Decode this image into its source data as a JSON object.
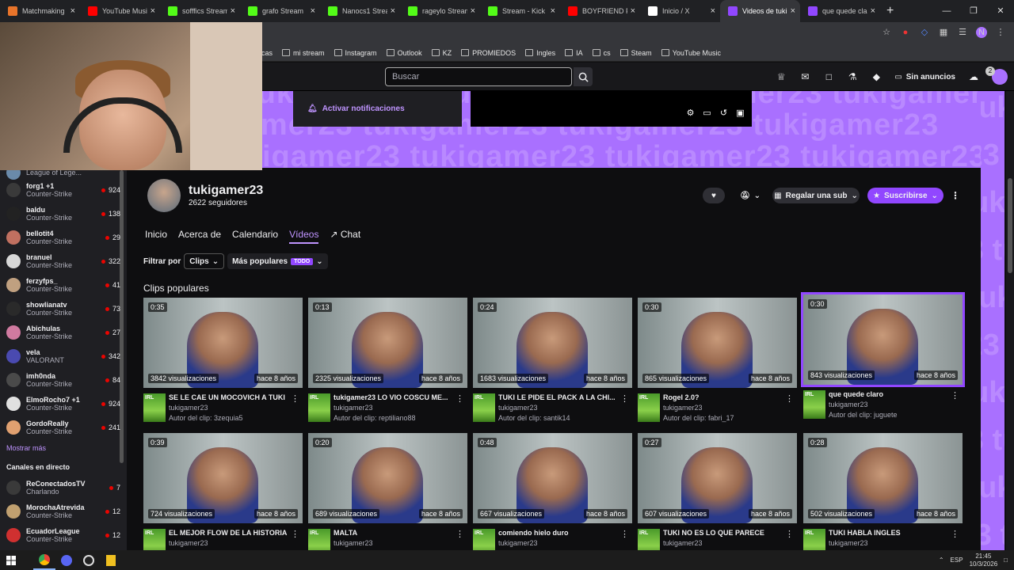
{
  "browser": {
    "tabs": [
      {
        "title": "Matchmaking",
        "fav": "#e8742a"
      },
      {
        "title": "YouTube Music",
        "fav": "#ff0000"
      },
      {
        "title": "sofffics Stream",
        "fav": "#53fc18"
      },
      {
        "title": "grafo Stream",
        "fav": "#53fc18"
      },
      {
        "title": "Nanocs1 Stream",
        "fav": "#53fc18"
      },
      {
        "title": "rageylo Stream",
        "fav": "#53fc18"
      },
      {
        "title": "Stream - Kick",
        "fav": "#53fc18"
      },
      {
        "title": "BOYFRIEND FT",
        "fav": "#ff0000"
      },
      {
        "title": "Inicio / X",
        "fav": "#ffffff"
      },
      {
        "title": "Videos de tuki",
        "fav": "#9147ff"
      },
      {
        "title": "que quede cla",
        "fav": "#9147ff"
      }
    ],
    "bookmarks": [
      "cas",
      "mi stream",
      "Instagram",
      "Outlook",
      "KZ",
      "PROMIEDOS",
      "Ingles",
      "IA",
      "cs",
      "Steam",
      "YouTube Music"
    ]
  },
  "twitch": {
    "search_placeholder": "Buscar",
    "noads_label": "Sin anuncios",
    "notif_count": "2",
    "activate_notifications": "Activar notificaciones"
  },
  "sidebar": {
    "channels": [
      {
        "name": "",
        "game": "League of Lege...",
        "viewers": "",
        "color": "#6a8aaa"
      },
      {
        "name": "forg1 +1",
        "game": "Counter-Strike",
        "viewers": "924",
        "color": "#3a3a3a"
      },
      {
        "name": "baldu",
        "game": "Counter-Strike",
        "viewers": "138",
        "color": "#222222"
      },
      {
        "name": "bellotit4",
        "game": "Counter-Strike",
        "viewers": "29",
        "color": "#c07060"
      },
      {
        "name": "branuel",
        "game": "Counter-Strike",
        "viewers": "322",
        "color": "#d8d8d8"
      },
      {
        "name": "ferzyfps_",
        "game": "Counter-Strike",
        "viewers": "41",
        "color": "#c0a080"
      },
      {
        "name": "showlianatv",
        "game": "Counter-Strike",
        "viewers": "73",
        "color": "#2a2a2a"
      },
      {
        "name": "Abichulas",
        "game": "Counter-Strike",
        "viewers": "27",
        "color": "#d07aa0"
      },
      {
        "name": "vela",
        "game": "VALORANT",
        "viewers": "342",
        "color": "#4a4ab0"
      },
      {
        "name": "imh0nda",
        "game": "Counter-Strike",
        "viewers": "84",
        "color": "#4a4a4a"
      },
      {
        "name": "ElmoRocho7 +1",
        "game": "Counter-Strike",
        "viewers": "924",
        "color": "#e0e0e0"
      },
      {
        "name": "GordoReally",
        "game": "Counter-Strike",
        "viewers": "241",
        "color": "#e0a070"
      }
    ],
    "show_more": "Mostrar más",
    "live_header": "Canales en directo",
    "live": [
      {
        "name": "ReConectadosTV",
        "game": "Charlando",
        "viewers": "7",
        "color": "#3a3a3a"
      },
      {
        "name": "MorochaAtrevida",
        "game": "Counter-Strike",
        "viewers": "12",
        "color": "#c0a070"
      },
      {
        "name": "EcuadorLeague",
        "game": "Counter-Strike",
        "viewers": "12",
        "color": "#d03030"
      }
    ]
  },
  "channel": {
    "name": "tukigamer23",
    "followers": "2622 seguidores",
    "gift_label": "Regalar una sub",
    "subscribe_label": "Suscribirse",
    "banner_text": "tukigamer23",
    "tabs": [
      "Inicio",
      "Acerca de",
      "Calendario",
      "Vídeos",
      "Chat"
    ],
    "filter_by": "Filtrar por",
    "filter_type": "Clips",
    "filter_sort": "Más populares",
    "filter_badge": "TODO",
    "section_title": "Clips populares"
  },
  "clips": [
    {
      "dur": "0:35",
      "views": "3842 visualizaciones",
      "ago": "hace 8 años",
      "title": "SE LE CAE UN MOCOVICH A TUKI",
      "channel": "tukigamer23",
      "author": "Autor del clip: 3zequia5"
    },
    {
      "dur": "0:13",
      "views": "2325 visualizaciones",
      "ago": "hace 8 años",
      "title": "tukigamer23 LO VIO COSCU ME...",
      "channel": "tukigamer23",
      "author": "Autor del clip: reptiliano88"
    },
    {
      "dur": "0:24",
      "views": "1683 visualizaciones",
      "ago": "hace 8 años",
      "title": "TUKI LE PIDE EL PACK A LA CHI...",
      "channel": "tukigamer23",
      "author": "Autor del clip: santik14"
    },
    {
      "dur": "0:30",
      "views": "865 visualizaciones",
      "ago": "hace 8 años",
      "title": "Rogel 2.0?",
      "channel": "tukigamer23",
      "author": "Autor del clip: fabri_17"
    },
    {
      "dur": "0:30",
      "views": "843 visualizaciones",
      "ago": "hace 8 años",
      "title": "que quede claro",
      "channel": "tukigamer23",
      "author": "Autor del clip: juguete"
    },
    {
      "dur": "0:39",
      "views": "724 visualizaciones",
      "ago": "hace 8 años",
      "title": "EL MEJOR FLOW DE LA HISTORIA",
      "channel": "tukigamer23",
      "author": ""
    },
    {
      "dur": "0:20",
      "views": "689 visualizaciones",
      "ago": "hace 8 años",
      "title": "MALTA",
      "channel": "tukigamer23",
      "author": ""
    },
    {
      "dur": "0:48",
      "views": "667 visualizaciones",
      "ago": "hace 8 años",
      "title": "comiendo hielo duro",
      "channel": "tukigamer23",
      "author": ""
    },
    {
      "dur": "0:27",
      "views": "607 visualizaciones",
      "ago": "hace 8 años",
      "title": "TUKI NO ES LO QUE PARECE",
      "channel": "tukigamer23",
      "author": ""
    },
    {
      "dur": "0:28",
      "views": "502 visualizaciones",
      "ago": "hace 8 años",
      "title": "TUKI HABLA INGLES",
      "channel": "tukigamer23",
      "author": ""
    }
  ],
  "game_icon_text": "IRL",
  "taskbar": {
    "lang": "ESP",
    "time": "21:45",
    "date": "10/3/2026"
  }
}
